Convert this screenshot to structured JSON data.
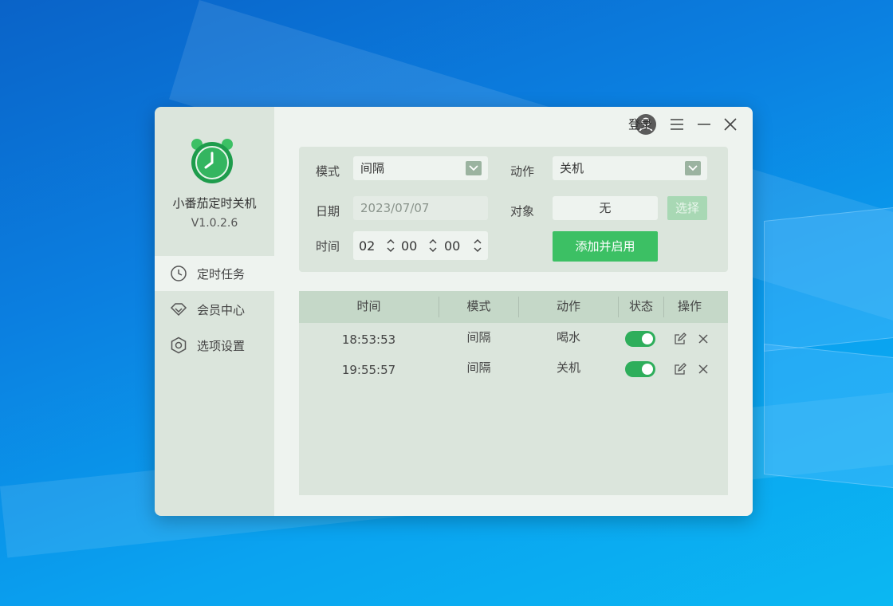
{
  "app": {
    "name": "小番茄定时关机",
    "version": "V1.0.2.6"
  },
  "titlebar": {
    "login_label": "登录",
    "icons": [
      "user-avatar-icon",
      "menu-icon",
      "minimize-icon",
      "close-icon"
    ]
  },
  "sidebar": {
    "items": [
      {
        "label": "定时任务",
        "icon": "clock-icon",
        "active": true
      },
      {
        "label": "会员中心",
        "icon": "diamond-icon",
        "active": false
      },
      {
        "label": "选项设置",
        "icon": "settings-icon",
        "active": false
      }
    ]
  },
  "form": {
    "mode_label": "模式",
    "mode_value": "间隔",
    "action_label": "动作",
    "action_value": "关机",
    "date_label": "日期",
    "date_value": "2023/07/07",
    "target_label": "对象",
    "target_value": "无",
    "choose_button": "选择",
    "time_label": "时间",
    "time_hour": "02",
    "time_minute": "00",
    "time_second": "00",
    "add_button": "添加并启用"
  },
  "table": {
    "columns": [
      "时间",
      "模式",
      "动作",
      "状态",
      "操作"
    ],
    "rows": [
      {
        "time": "18:53:53",
        "mode": "间隔",
        "action": "喝水",
        "enabled": true
      },
      {
        "time": "19:55:57",
        "mode": "间隔",
        "action": "关机",
        "enabled": true
      }
    ]
  },
  "colors": {
    "accent_green": "#3cc064",
    "toggle_on": "#2eae5b",
    "sidebar_bg": "#dbe5dc",
    "main_bg": "#eef3ef"
  }
}
